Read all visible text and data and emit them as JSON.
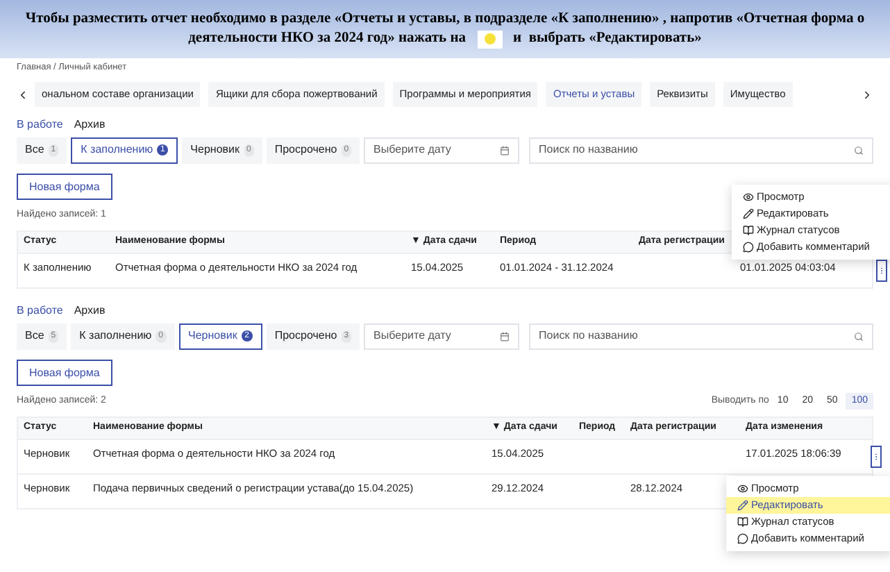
{
  "banner": {
    "line_1": "Чтобы разместить отчет необходимо в разделе «Отчеты и уставы, в подразделе «К заполнению» , напротив «Отчетная форма о",
    "line_2_before": "деятельности НКО за 2024 год» нажать на",
    "line_2_after": "и  выбрать «Редактировать»"
  },
  "breadcrumb": "Главная / Личный кабинет",
  "nav_tabs": [
    {
      "label": "ональном составе организации",
      "selected": false
    },
    {
      "label": "Ящики для сбора пожертвований",
      "selected": false
    },
    {
      "label": "Программы и мероприятия",
      "selected": false
    },
    {
      "label": "Отчеты и уставы",
      "selected": true
    },
    {
      "label": "Реквизиты",
      "selected": false
    },
    {
      "label": "Имущество",
      "selected": false
    }
  ],
  "sections": [
    {
      "subtabs": [
        {
          "label": "В работе",
          "selected": true
        },
        {
          "label": "Архив",
          "selected": false
        }
      ],
      "filters": [
        {
          "label": "Все",
          "count": "1",
          "selected": false
        },
        {
          "label": "К заполнению",
          "count": "1",
          "selected": true
        },
        {
          "label": "Черновик",
          "count": "0",
          "selected": false
        },
        {
          "label": "Просрочено",
          "count": "0",
          "selected": false
        }
      ],
      "date_placeholder": "Выберите дату",
      "search_placeholder": "Поиск по названию",
      "new_button": "Новая форма",
      "found": "Найдено записей: 1",
      "columns": [
        "Статус",
        "Наименование формы",
        "▼ Дата сдачи",
        "Период",
        "Дата регистрации"
      ],
      "rows": [
        {
          "cells": [
            "К заполнению",
            "Отчетная форма о деятельности НКО за 2024 год",
            "15.04.2025",
            "01.01.2024 - 31.12.2024",
            "",
            "01.01.2025 04:03:04"
          ],
          "menu": [
            {
              "label": "Просмотр",
              "kind": "view",
              "selected": false
            },
            {
              "label": "Редактировать",
              "kind": "edit",
              "selected": false
            },
            {
              "label": "Журнал статусов",
              "kind": "log",
              "selected": false
            },
            {
              "label": "Добавить комментарий",
              "kind": "comment",
              "selected": false
            }
          ]
        }
      ]
    },
    {
      "subtabs": [
        {
          "label": "В работе",
          "selected": true
        },
        {
          "label": "Архив",
          "selected": false
        }
      ],
      "filters": [
        {
          "label": "Все",
          "count": "5",
          "selected": false
        },
        {
          "label": "К заполнению",
          "count": "0",
          "selected": false
        },
        {
          "label": "Черновик",
          "count": "2",
          "selected": true
        },
        {
          "label": "Просрочено",
          "count": "3",
          "selected": false
        }
      ],
      "date_placeholder": "Выберите дату",
      "search_placeholder": "Поиск по названию",
      "new_button": "Новая форма",
      "found": "Найдено записей: 2",
      "page_size": {
        "label": "Выводить по",
        "options": [
          {
            "label": "10",
            "selected": false
          },
          {
            "label": "20",
            "selected": false
          },
          {
            "label": "50",
            "selected": false
          },
          {
            "label": "100",
            "selected": true
          }
        ]
      },
      "columns": [
        "Статус",
        "Наименование формы",
        "▼ Дата сдачи",
        "Период",
        "Дата регистрации",
        "Дата изменения"
      ],
      "rows": [
        {
          "cells": [
            "Черновик",
            "Отчетная форма о деятельности НКО за 2024 год",
            "15.04.2025",
            "",
            "",
            "17.01.2025 18:06:39"
          ],
          "menu": [
            {
              "label": "Просмотр",
              "kind": "view",
              "selected": false
            },
            {
              "label": "Редактировать",
              "kind": "edit",
              "selected": true
            },
            {
              "label": "Журнал статусов",
              "kind": "log",
              "selected": false
            },
            {
              "label": "Добавить комментарий",
              "kind": "comment",
              "selected": false
            }
          ]
        },
        {
          "cells": [
            "Черновик",
            "Подача первичных сведений о регистрации устава(до 15.04.2025)",
            "29.12.2024",
            "",
            "28.12.2024",
            ""
          ]
        }
      ]
    }
  ]
}
